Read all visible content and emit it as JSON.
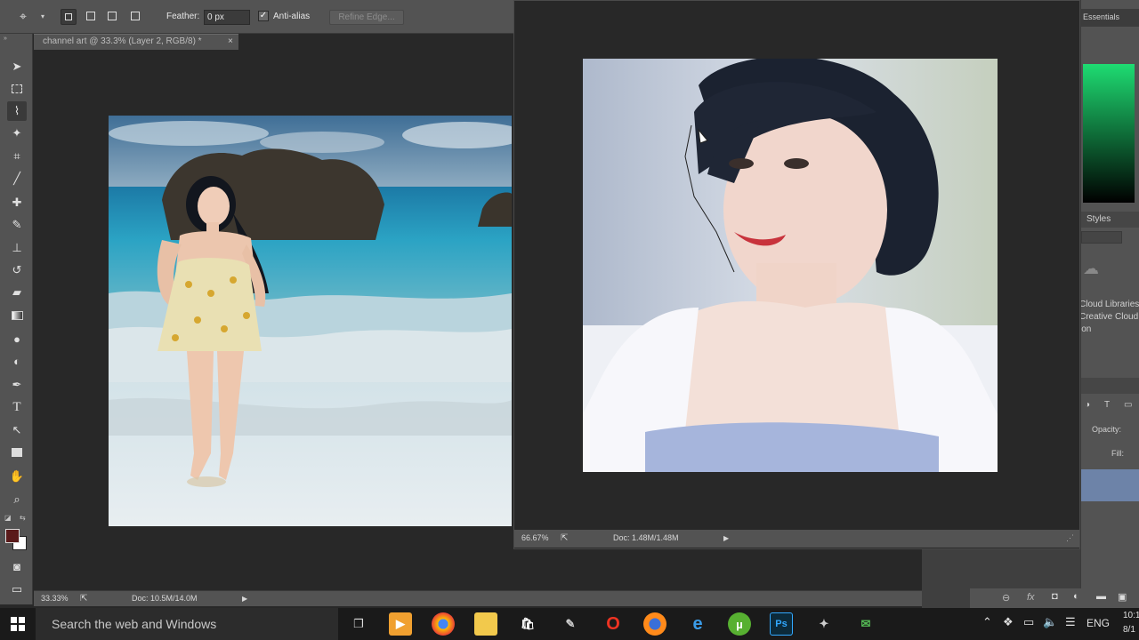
{
  "options_bar": {
    "feather_label": "Feather:",
    "feather_value": "0 px",
    "antialias_label": "Anti-alias",
    "antialias_checked": true,
    "refine_edge_label": "Refine Edge..."
  },
  "document": {
    "tab_title": "channel art @ 33.3% (Layer 2, RGB/8) *",
    "close_glyph": "×",
    "zoom": "33.33%",
    "doc_size": "Doc: 10.5M/14.0M"
  },
  "float_window": {
    "zoom": "66.67%",
    "doc_size": "Doc: 1.48M/1.48M"
  },
  "dock": {
    "workspace": "Essentials",
    "styles_tab": "Styles",
    "cc_lines": [
      "Cloud Libraries,",
      "Creative Cloud",
      "ion"
    ],
    "opacity_label": "Opacity:",
    "fill_label": "Fill:"
  },
  "taskbar": {
    "search_placeholder": "Search the web and Windows",
    "language": "ENG",
    "time": "10:1",
    "date": "8/1"
  },
  "colors": {
    "foreground": "#5a1a1a",
    "background": "#ffffff",
    "color_panel_top": "#1edc72",
    "color_panel_bottom": "#000000"
  }
}
